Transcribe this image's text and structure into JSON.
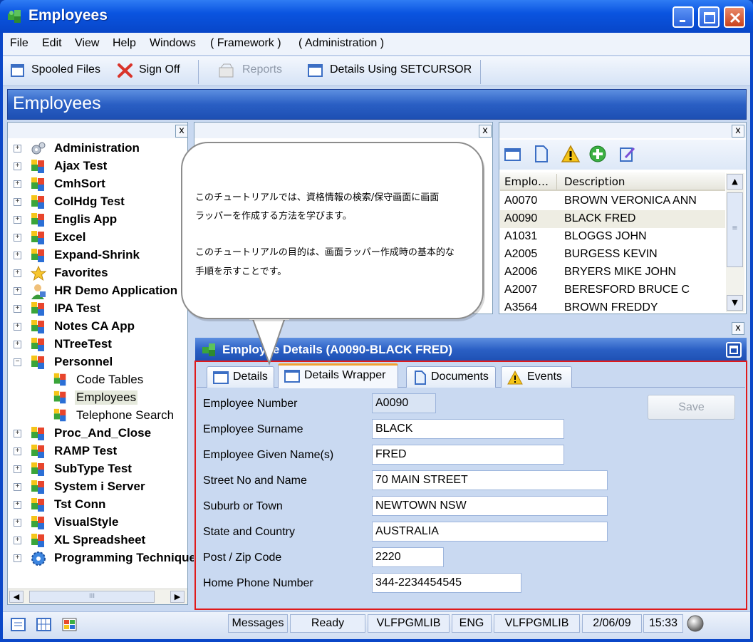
{
  "window": {
    "title": "Employees"
  },
  "menu": [
    "File",
    "Edit",
    "View",
    "Help",
    "Windows",
    "( Framework )",
    "( Administration )"
  ],
  "toolbar": {
    "spooled": "Spooled Files",
    "signoff": "Sign Off",
    "reports": "Reports",
    "details": "Details Using SETCURSOR"
  },
  "header": {
    "title": "Employees"
  },
  "close_glyph": "x",
  "tree": {
    "items": [
      {
        "label": "Administration",
        "icon": "gears-icon",
        "state": "+"
      },
      {
        "label": "Ajax Test",
        "icon": "puzzle-icon",
        "state": "+"
      },
      {
        "label": "CmhSort",
        "icon": "puzzle-icon",
        "state": "+"
      },
      {
        "label": "ColHdg Test",
        "icon": "puzzle-icon",
        "state": "+"
      },
      {
        "label": "Englis App",
        "icon": "puzzle-icon",
        "state": "+"
      },
      {
        "label": "Excel",
        "icon": "puzzle-icon",
        "state": "+"
      },
      {
        "label": "Expand-Shrink",
        "icon": "puzzle-icon",
        "state": "+"
      },
      {
        "label": "Favorites",
        "icon": "star-icon",
        "state": "+"
      },
      {
        "label": "HR Demo Application",
        "icon": "person-icon",
        "state": "+"
      },
      {
        "label": "IPA Test",
        "icon": "puzzle-icon",
        "state": "+"
      },
      {
        "label": "Notes CA App",
        "icon": "puzzle-icon",
        "state": "+"
      },
      {
        "label": "NTreeTest",
        "icon": "puzzle-icon",
        "state": "+"
      },
      {
        "label": "Personnel",
        "icon": "puzzle-icon",
        "state": "−"
      }
    ],
    "personnel_children": [
      "Code Tables",
      "Employees",
      "Telephone Search"
    ],
    "items_after": [
      {
        "label": "Proc_And_Close",
        "icon": "puzzle-icon",
        "state": "+"
      },
      {
        "label": "RAMP Test",
        "icon": "puzzle-icon",
        "state": "+"
      },
      {
        "label": "SubType Test",
        "icon": "puzzle-icon",
        "state": "+"
      },
      {
        "label": "System i Server",
        "icon": "puzzle-icon",
        "state": "+"
      },
      {
        "label": "Tst Conn",
        "icon": "puzzle-icon",
        "state": "+"
      },
      {
        "label": "VisualStyle",
        "icon": "puzzle-icon",
        "state": "+"
      },
      {
        "label": "XL Spreadsheet",
        "icon": "puzzle-icon",
        "state": "+"
      },
      {
        "label": "Programming Techniques",
        "icon": "gear-blue-icon",
        "state": "+"
      }
    ],
    "selected": "Employees",
    "scroll_glyph": "III"
  },
  "balloon": {
    "line1": "このチュートリアルでは、資格情報の検索/保守画面に画面",
    "line2": "ラッパーを作成する方法を学びます。",
    "line3": "このチュートリアルの目的は、画面ラッパー作成時の基本的な",
    "line4": "手順を示すことです。"
  },
  "list": {
    "col1": "Emplo…",
    "col2": "Description",
    "rows": [
      {
        "id": "A0070",
        "name": "BROWN VERONICA ANN"
      },
      {
        "id": "A0090",
        "name": "BLACK FRED"
      },
      {
        "id": "A1031",
        "name": "BLOGGS JOHN"
      },
      {
        "id": "A2005",
        "name": "BURGESS KEVIN"
      },
      {
        "id": "A2006",
        "name": "BRYERS MIKE JOHN"
      },
      {
        "id": "A2007",
        "name": "BERESFORD BRUCE C"
      },
      {
        "id": "A3564",
        "name": "BROWN FREDDY"
      }
    ],
    "selected": "A0090"
  },
  "details": {
    "title": "Employee Details (A0090-BLACK FRED)",
    "tabs": [
      "Details",
      "Details Wrapper",
      "Documents",
      "Events"
    ],
    "active_tab": "Details Wrapper",
    "save": "Save",
    "fields": [
      {
        "label": "Employee Number",
        "value": "A0090",
        "readonly": true
      },
      {
        "label": "Employee Surname",
        "value": "BLACK"
      },
      {
        "label": "Employee Given Name(s)",
        "value": "FRED"
      },
      {
        "label": "Street No and Name",
        "value": "70 MAIN STREET"
      },
      {
        "label": "Suburb or Town",
        "value": "NEWTOWN NSW"
      },
      {
        "label": "State and Country",
        "value": "AUSTRALIA"
      },
      {
        "label": "Post / Zip Code",
        "value": "2220"
      },
      {
        "label": "Home Phone Number",
        "value": "344-2234454545"
      }
    ]
  },
  "status": {
    "messages": "Messages",
    "state": "Ready",
    "lib1": "VLFPGMLIB",
    "lang": "ENG",
    "lib2": "VLFPGMLIB",
    "date": "2/06/09",
    "time": "15:33"
  },
  "colors": {
    "accent": "#0b47c8",
    "highlight_frame": "#e01a1a",
    "panel": "#c9d9f1"
  }
}
